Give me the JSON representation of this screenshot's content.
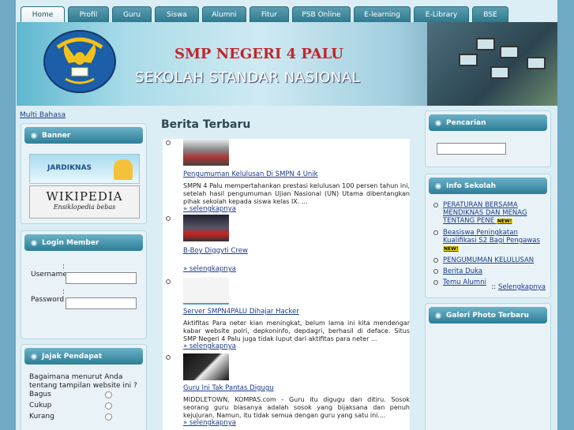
{
  "nav": {
    "tabs": [
      {
        "label": "Home",
        "active": true
      },
      {
        "label": "Profil"
      },
      {
        "label": "Guru"
      },
      {
        "label": "Siswa"
      },
      {
        "label": "Alumni"
      },
      {
        "label": "Fitur"
      },
      {
        "label": "PSB Online"
      },
      {
        "label": "E-learning"
      },
      {
        "label": "E-Library"
      },
      {
        "label": "BSE"
      }
    ]
  },
  "banner": {
    "logo_text": "TUT WURI HANDAYANI",
    "school_name": "SMP NEGERI 4 PALU",
    "subtitle": "SEKOLAH STANDAR NASIONAL"
  },
  "left": {
    "multi_bahasa": "Multi Bahasa",
    "banner_box": {
      "title": "Banner",
      "jardiknas": "JARDIKNAS",
      "wikipedia": "WIKIPEDIA",
      "wikipedia_sub": "Ensiklopedia bebas"
    },
    "login": {
      "title": "Login Member",
      "username_label": "Username",
      "password_label": "Password",
      "colon": ":",
      "username_value": "",
      "password_value": ""
    },
    "poll": {
      "title": "Jajak Pendapat",
      "question": "Bagaimana menurut Anda tentang tampilan website ini ?",
      "options": [
        "Bagus",
        "Cukup",
        "Kurang"
      ]
    }
  },
  "center": {
    "title": "Berita Terbaru",
    "more_label": "» selengkapnya",
    "news": [
      {
        "title": "Pengumuman Kelulusan Di SMPN 4 Unik",
        "text": "SMPN 4 Palu mempertahankan prestasi kelulusan 100 persen tahun ini, setelah hasil pengumuman Ujian Nasional (UN) Utama dibentangkan pihak sekolah kepada siswa kelas IX. ..."
      },
      {
        "title": "B-Boy Diggyti Crew",
        "text": ""
      },
      {
        "title": "Server SMPN4PALU Dihajar Hacker",
        "text": "Aktifitas Para neter kian meningkat, belum lama ini kita mendengar kabar website polri, depkoninfo, depdagri, berhasil di deface. Situs SMP Negeri 4 Palu juga tidak luput dari aktifitas para neter ..."
      },
      {
        "title": "Guru Ini Tak Pantas Digugu",
        "text": "MIDDLETOWN, KOMPAS.com - Guru itu digugu dan ditiru. Sosok seorang guru biasanya adalah sosok yang bijaksana dan penuh kejujuran. Namun, itu tidak semua dengan guru yang satu ini...."
      }
    ]
  },
  "right": {
    "search": {
      "title": "Pencarian",
      "value": ""
    },
    "info": {
      "title": "Info Sekolah",
      "items": [
        "PERATURAN BERSAMA MENDIKNAS DAN MENAG TENTANG PENE",
        "Beasiswa Peningkatan Kualifikasi S2 Bagi Pengawas",
        "PENGUMUMAN KELULUSAN",
        "Berita Duka",
        "Temu Alumni"
      ],
      "new_badge": "NEW!",
      "more_prefix": "::",
      "more": "Selengkapnya"
    },
    "gallery": {
      "title": "Galeri Photo Terbaru"
    }
  }
}
